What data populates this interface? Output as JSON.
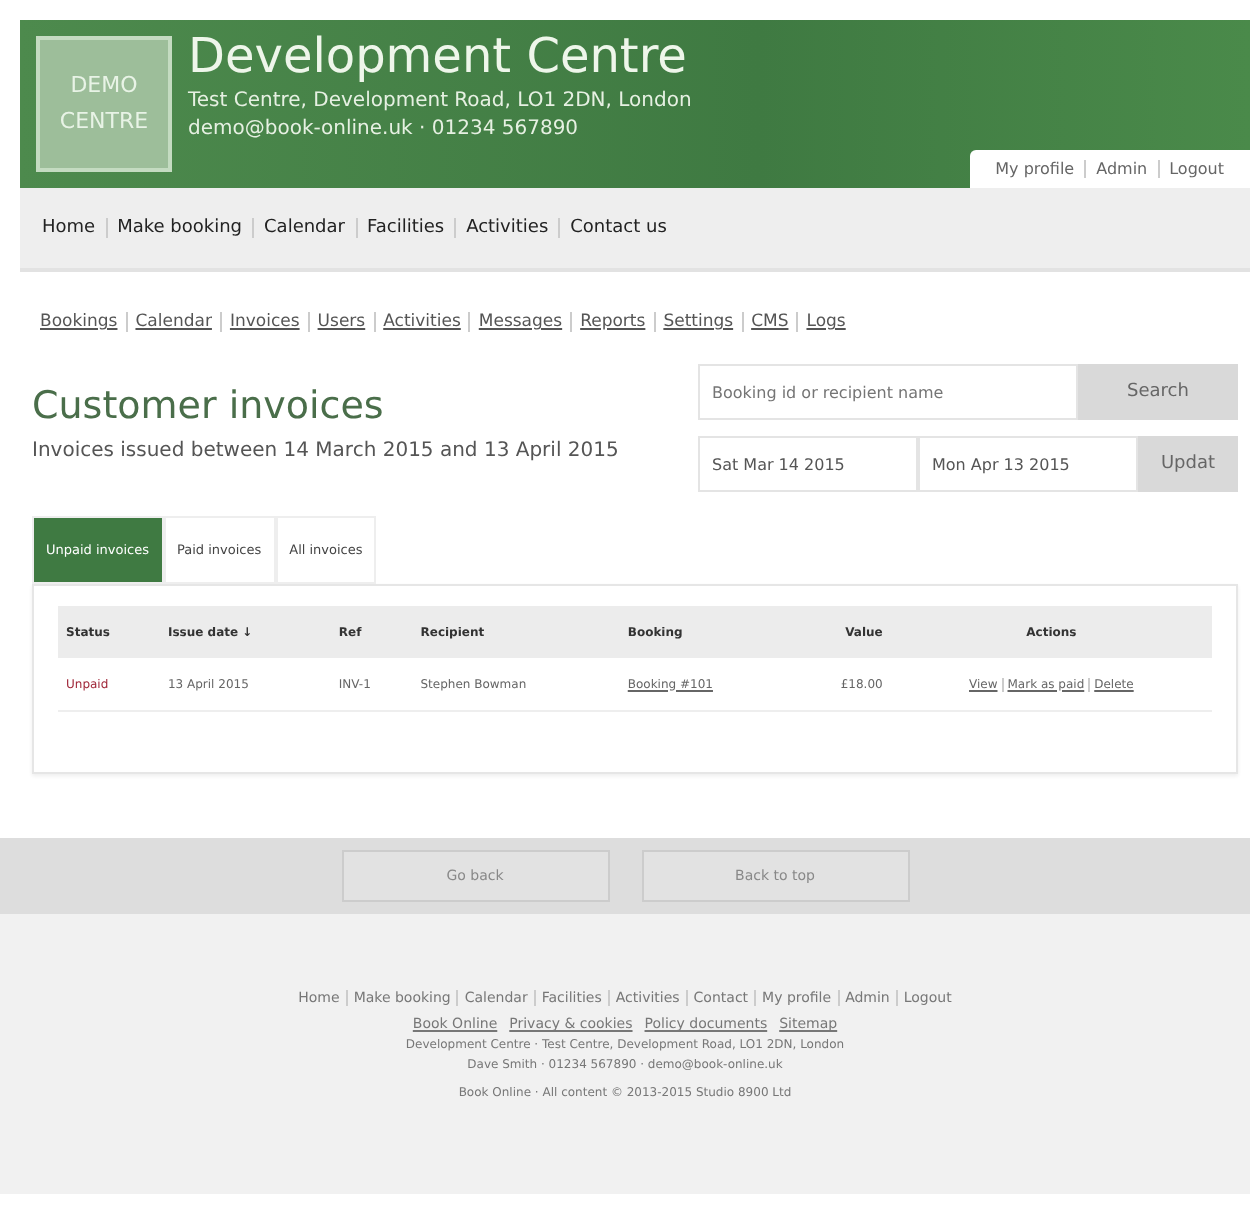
{
  "header": {
    "logo": [
      "DEMO",
      "CENTRE"
    ],
    "title": "Development Centre",
    "address": "Test Centre, Development Road, LO1 2DN, London",
    "contact": "demo@book-online.uk · 01234 567890",
    "user_links": [
      "My profile",
      "Admin",
      "Logout"
    ]
  },
  "main_nav": [
    "Home",
    "Make booking",
    "Calendar",
    "Facilities",
    "Activities",
    "Contact us"
  ],
  "admin_nav": [
    "Bookings",
    "Calendar",
    "Invoices",
    "Users",
    "Activities",
    "Messages",
    "Reports",
    "Settings",
    "CMS",
    "Logs"
  ],
  "page": {
    "title": "Customer invoices",
    "subtitle": "Invoices issued between 14 March 2015 and 13 April 2015"
  },
  "search": {
    "placeholder": "Booking id or recipient name",
    "button": "Search"
  },
  "date_range": {
    "from": "Sat Mar 14 2015",
    "to": "Mon Apr 13 2015",
    "button": "Updat"
  },
  "tabs": [
    {
      "label": "Unpaid invoices",
      "selected": true
    },
    {
      "label": "Paid invoices",
      "selected": false
    },
    {
      "label": "All invoices",
      "selected": false
    }
  ],
  "table": {
    "columns": [
      "Status",
      "Issue date ↓",
      "Ref",
      "Recipient",
      "Booking",
      "Value",
      "Actions"
    ],
    "rows": [
      {
        "status": "Unpaid",
        "issue_date": "13 April 2015",
        "ref": "INV-1",
        "recipient": "Stephen Bowman",
        "booking": "Booking #101",
        "value": "£18.00",
        "actions": [
          "View",
          "Mark as paid",
          "Delete"
        ]
      }
    ]
  },
  "bottom_buttons": [
    "Go back",
    "Back to top"
  ],
  "footer": {
    "links": [
      "Home",
      "Make booking",
      "Calendar",
      "Facilities",
      "Activities",
      "Contact",
      "My profile",
      "Admin",
      "Logout"
    ],
    "links_2": [
      "Book Online",
      "Privacy & cookies",
      "Policy documents",
      "Sitemap"
    ],
    "address": "Development Centre · Test Centre, Development Road, LO1 2DN, London",
    "contact": "Dave Smith · 01234 567890 · demo@book-online.uk",
    "copyright": "Book Online · All content © 2013-2015 Studio 8900 Ltd"
  }
}
